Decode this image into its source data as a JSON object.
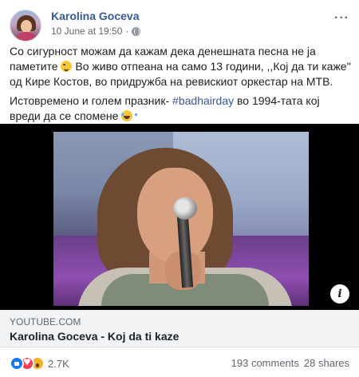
{
  "post": {
    "author": "Karolina Goceva",
    "timestamp": "10 June at 19:50",
    "separator": "·",
    "paragraph1": "Со сигурност можам да кажам дека денешната песна не ја паметите",
    "paragraph2": "Во живо отпеана на само 13 години, ,,Кој да ти каже'' од Кире Костов, во придружба на ревискиот оркестар на МТВ.",
    "paragraph3_before": "Истовремено и голем празник- ",
    "hashtag": "#badhairday",
    "paragraph3_after": " во 1994-тата кој вреди да се спомене",
    "more_label": "···"
  },
  "icons": {
    "privacy": "globe-icon",
    "more": "more-icon",
    "info": "info-icon",
    "reactions": [
      "like-icon",
      "love-icon",
      "wow-icon"
    ]
  },
  "video": {
    "info_label": "i"
  },
  "link_preview": {
    "domain": "YOUTUBE.COM",
    "title": "Karolina Goceva - Koj da ti kaze"
  },
  "stats": {
    "reactions": "2.7K",
    "comments": "193 comments",
    "shares": "28 shares"
  },
  "colors": {
    "author_link": "#385898",
    "secondary_text": "#606770",
    "preview_bg": "#f2f3f5"
  }
}
